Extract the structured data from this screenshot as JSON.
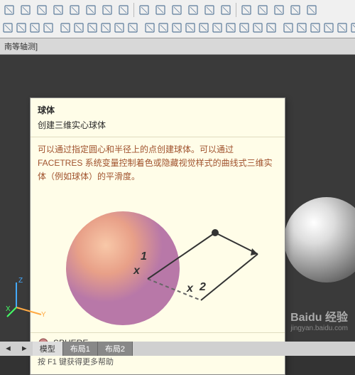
{
  "toolbar": {
    "row1_icons": [
      "box",
      "box-wire",
      "wedge",
      "cylinder",
      "cone",
      "sphere",
      "torus",
      "pyramid",
      "helix",
      "donut",
      "cube",
      "cube-wire",
      "cube-shade",
      "cube-shade2",
      "dim-linear",
      "dim-angular",
      "arc",
      "dim-radius",
      "dim-diameter"
    ],
    "row2_icons": [
      "poly",
      "mesh",
      "spiral",
      "pan",
      "orbit",
      "zoom",
      "help",
      "layers",
      "grid",
      "snap",
      "ortho",
      "polar",
      "osnap",
      "otrack",
      "ducs",
      "dyn",
      "lwt",
      "tpy",
      "sphere-solid",
      "torus-solid",
      "revolve",
      "extrude",
      "sweep",
      "loft",
      "section",
      "slice",
      "shell",
      "wedge2",
      "grid2",
      "origin",
      "wire",
      "shade",
      "render",
      "plus"
    ]
  },
  "context_label": "南等轴测]",
  "tooltip": {
    "title": "球体",
    "subtitle": "创建三维实心球体",
    "description": "可以通过指定圆心和半径上的点创建球体。可以通过 FACETRES 系统变量控制着色或隐藏视觉样式的曲线式三维实体（例如球体）的平滑度。",
    "labels": {
      "p1": "1",
      "p2": "2",
      "x1": "x",
      "x2": "x"
    },
    "command": "SPHERE",
    "help": "按 F1 键获得更多帮助"
  },
  "axis": {
    "x": "X",
    "y": "Y",
    "z": "Z"
  },
  "tabs": {
    "arrows": [
      "◄",
      "►"
    ],
    "items": [
      "模型",
      "布局1",
      "布局2"
    ]
  },
  "watermark": {
    "brand": "Baidu 经验",
    "url": "jingyan.baidu.com"
  }
}
